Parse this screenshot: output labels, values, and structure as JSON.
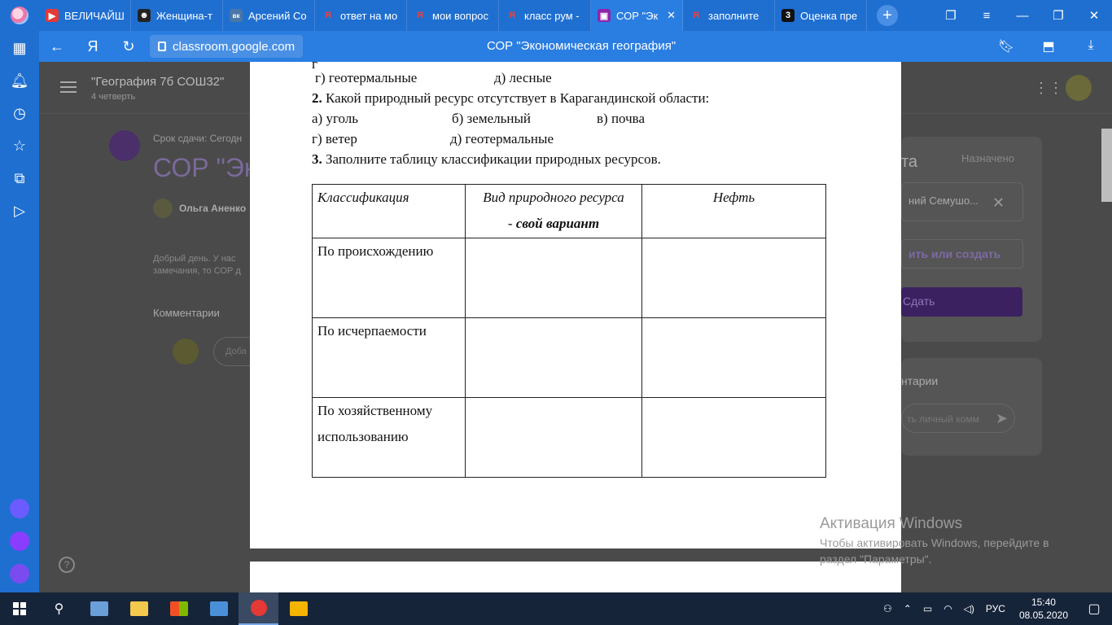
{
  "browser": {
    "tabs": [
      {
        "label": "ВЕЛИЧАЙШ",
        "fav": "▶",
        "fav_color": "#e53935"
      },
      {
        "label": "Женщина-т",
        "fav": "☻",
        "fav_color": "#222222"
      },
      {
        "label": "Арсений Со",
        "fav": "вк",
        "fav_color": "#4a76a8"
      },
      {
        "label": "ответ на мо",
        "fav": "Я",
        "fav_color": "#e53935"
      },
      {
        "label": "мои вопрос",
        "fav": "Я",
        "fav_color": "#e53935"
      },
      {
        "label": "класс рум -",
        "fav": "Я",
        "fav_color": "#e53935"
      },
      {
        "label": "СОР \"Эк",
        "fav": "▣",
        "fav_color": "#8e24aa",
        "active": true
      },
      {
        "label": "заполните",
        "fav": "Я",
        "fav_color": "#e53935"
      },
      {
        "label": "Оценка пре",
        "fav": "3",
        "fav_color": "#111111"
      }
    ],
    "new_tab": "+",
    "url": "classroom.google.com",
    "page_title": "СОР \"Экономическая география\"",
    "accent": "#2a7de1"
  },
  "classroom": {
    "course_title": "\"География 7б СОШ32\"",
    "course_sub": "4 четверть",
    "due": "Срок сдачи: Сегодн",
    "title": "СОР \"Эк",
    "author": "Ольга Аненко",
    "desc_line1": "Добрый день. У нас",
    "desc_line2": "замечания, то СОР д",
    "comments_heading": "Комментарии",
    "comment_placeholder": "Доба",
    "right_title": "та",
    "assigned": "Назначено",
    "chip": "ний Семушо...",
    "add_create": "ить или создать",
    "submit": "Сдать",
    "private_comments": "нтарии",
    "private_placeholder": "ть личный комм"
  },
  "document": {
    "line_top_partial": "г) геотермальные",
    "line_top_partial2": "д) лесные",
    "q2_num": "2.",
    "q2_text": " Какой природный ресурс отсутствует в Карагандинской области:",
    "q2_a": "а) уголь",
    "q2_b": "б) земельный",
    "q2_c": "в) почва",
    "q2_d": "г) ветер",
    "q2_e": "д) геотермальные",
    "q3_num": "3.",
    "q3_text": " Заполните таблицу классификации природных  ресурсов.",
    "table": {
      "col1": "Классификация",
      "col2_line1": "Вид  природного ресурса",
      "col2_line2_prefix": "- ",
      "col2_line2_bold": "свой вариант",
      "col3": "Нефть",
      "rows": [
        "По происхождению",
        "По исчерпаемости",
        "По хозяйственному использованию"
      ]
    }
  },
  "activation": {
    "title": "Активация Windows",
    "message": "Чтобы активировать Windows, перейдите в раздел \"Параметры\"."
  },
  "taskbar": {
    "lang": "РУС",
    "time": "15:40",
    "date": "08.05.2020"
  }
}
